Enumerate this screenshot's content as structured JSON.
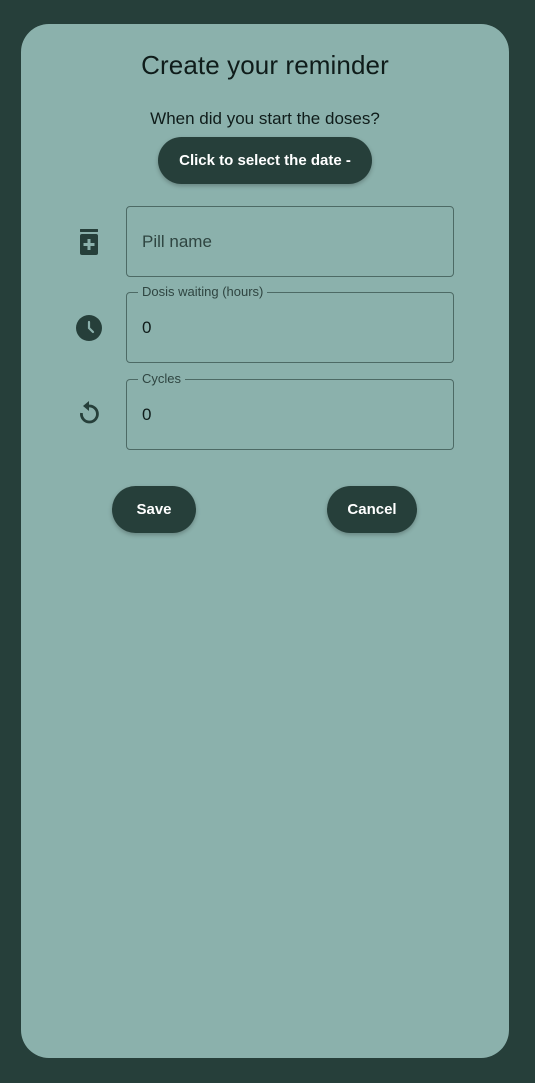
{
  "header": {
    "title": "Create your reminder",
    "subtitle": "When did you start the doses?"
  },
  "date_button": {
    "label": "Click to select the date -"
  },
  "fields": {
    "pill_name": {
      "placeholder": "Pill name",
      "value": "",
      "icon": "medication-icon"
    },
    "dosis_waiting": {
      "label": "Dosis waiting (hours)",
      "value": "0",
      "icon": "clock-icon"
    },
    "cycles": {
      "label": "Cycles",
      "value": "0",
      "icon": "replay-icon"
    }
  },
  "actions": {
    "save_label": "Save",
    "cancel_label": "Cancel"
  },
  "colors": {
    "background": "#263f3a",
    "card": "#8bb1ac",
    "primary": "#263f3a",
    "on_primary": "#ffffff"
  }
}
